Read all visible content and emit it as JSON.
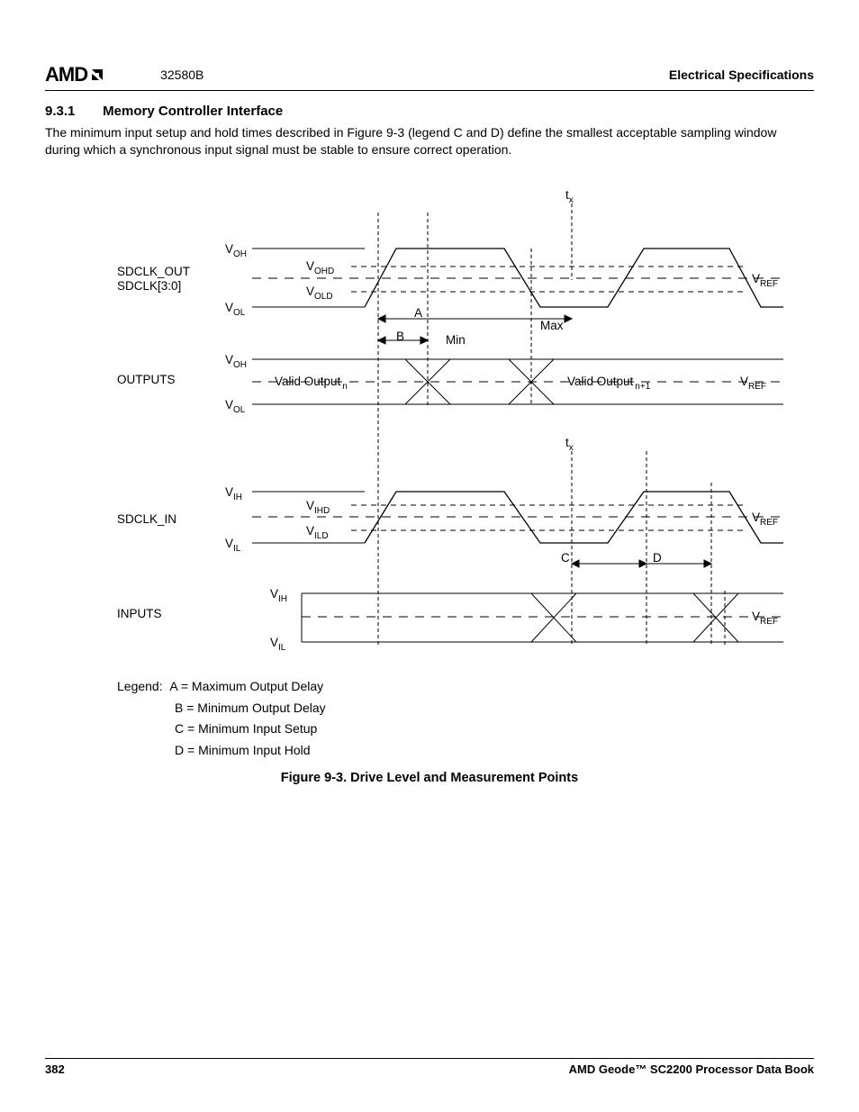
{
  "header": {
    "logo": "AMD",
    "doc_number": "32580B",
    "section_label": "Electrical Specifications"
  },
  "section": {
    "number": "9.3.1",
    "title": "Memory Controller Interface"
  },
  "paragraph": "The minimum input setup and hold times described in Figure 9-3 (legend C and D) define the smallest acceptable sampling window during which a synchronous input signal must be stable to ensure correct operation.",
  "diagram": {
    "row1_label_a": "SDCLK_OUT",
    "row1_label_b": "SDCLK[3:0]",
    "row2_label": "OUTPUTS",
    "row3_label": "SDCLK_IN",
    "row4_label": "INPUTS",
    "voh": "V",
    "voh_sub": "OH",
    "vol": "V",
    "vol_sub": "OL",
    "vohd": "V",
    "vohd_sub": "OHD",
    "vold": "V",
    "vold_sub": "OLD",
    "vih": "V",
    "vih_sub": "IH",
    "vil": "V",
    "vil_sub": "IL",
    "vihd": "V",
    "vihd_sub": "IHD",
    "vild": "V",
    "vild_sub": "ILD",
    "vref": "V",
    "vref_sub": "REF",
    "tx": "t",
    "tx_sub": "x",
    "A": "A",
    "B": "B",
    "Min": "Min",
    "Max": "Max",
    "C": "C",
    "D": "D",
    "valid_out_n_pre": "Valid Output",
    "valid_out_n_sub": "n",
    "valid_out_n1_pre": "Valid Output",
    "valid_out_n1_sub": "n+1"
  },
  "legend": {
    "lead": "Legend:",
    "A": "A = Maximum Output Delay",
    "B": "B = Minimum Output Delay",
    "C": "C = Minimum Input Setup",
    "D": "D = Minimum Input Hold"
  },
  "figure_caption": "Figure 9-3.  Drive Level and Measurement Points",
  "footer": {
    "page": "382",
    "book": "AMD Geode™ SC2200  Processor Data Book"
  }
}
